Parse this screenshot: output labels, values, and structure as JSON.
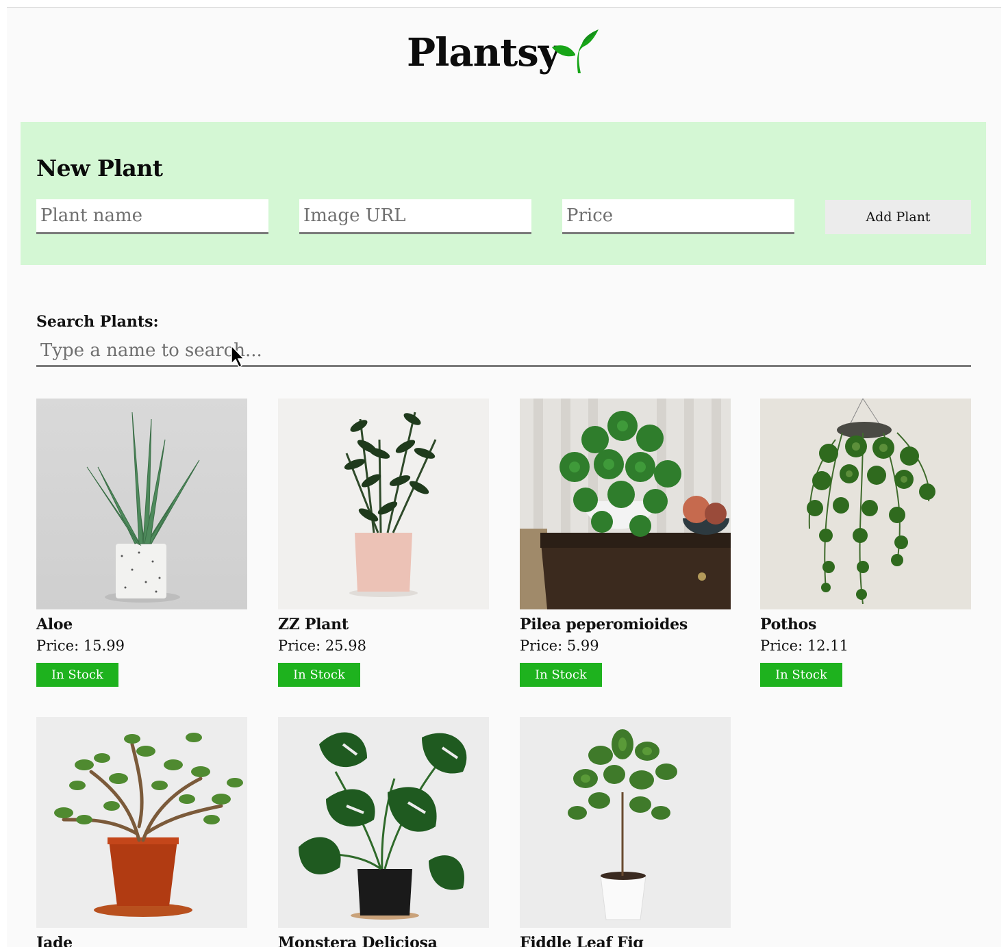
{
  "app": {
    "title": "Plantsy",
    "logo_icon": "sprout-icon",
    "brand_green": "#1eb21e"
  },
  "new_plant": {
    "heading": "New Plant",
    "name_placeholder": "Plant name",
    "image_placeholder": "Image URL",
    "price_placeholder": "Price",
    "submit_label": "Add Plant",
    "background": "#d4f7d4"
  },
  "search": {
    "label": "Search Plants:",
    "placeholder": "Type a name to search..."
  },
  "plants": [
    {
      "name": "Aloe",
      "price": "Price: 15.99",
      "status": "In Stock"
    },
    {
      "name": "ZZ Plant",
      "price": "Price: 25.98",
      "status": "In Stock"
    },
    {
      "name": "Pilea peperomioides",
      "price": "Price: 5.99",
      "status": "In Stock"
    },
    {
      "name": "Pothos",
      "price": "Price: 12.11",
      "status": "In Stock"
    },
    {
      "name": "Jade"
    },
    {
      "name": "Monstera Deliciosa"
    },
    {
      "name": "Fiddle Leaf Fig"
    }
  ]
}
